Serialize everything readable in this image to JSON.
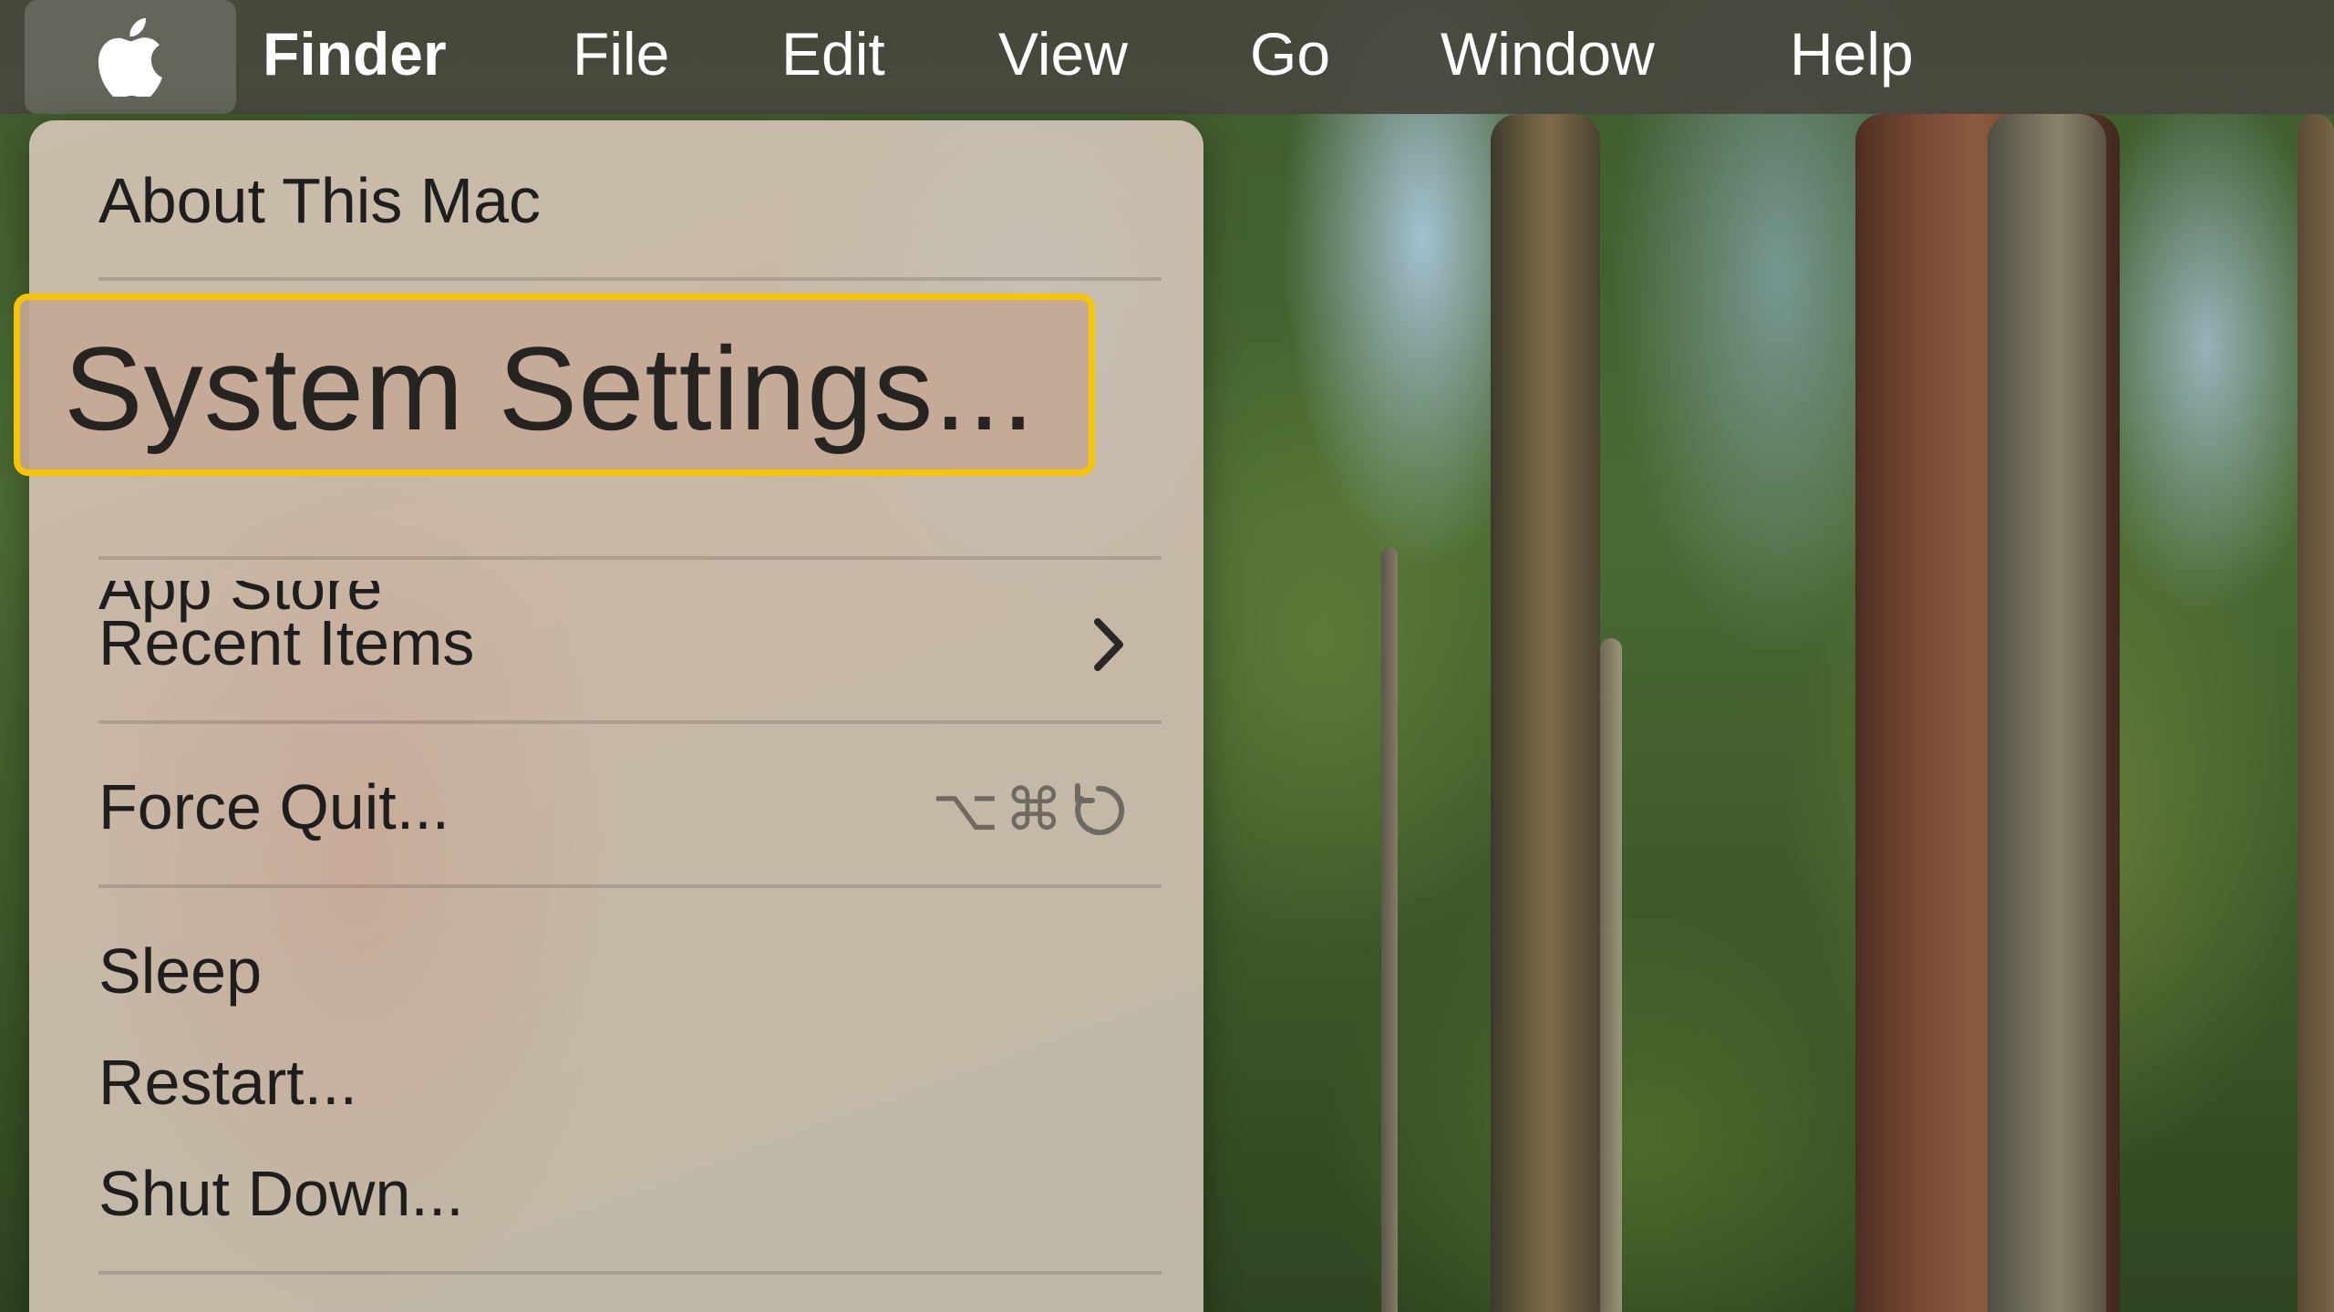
{
  "menubar": {
    "apple_icon": "apple-logo-icon",
    "app_name": "Finder",
    "menus": [
      "File",
      "Edit",
      "View",
      "Go",
      "Window",
      "Help"
    ]
  },
  "apple_menu": {
    "items": {
      "about": "About This Mac",
      "system_settings": "System Settings...",
      "app_store": "App Store",
      "recent_items": "Recent Items",
      "force_quit": "Force Quit...",
      "sleep": "Sleep",
      "restart": "Restart...",
      "shut_down": "Shut Down..."
    },
    "recent_items_icon": "chevron-right-icon",
    "force_quit_shortcut": {
      "option": "⌥",
      "command": "⌘",
      "escape_icon": "escape-icon"
    }
  },
  "highlight": {
    "color": "#f6c400",
    "target": "System Settings..."
  }
}
